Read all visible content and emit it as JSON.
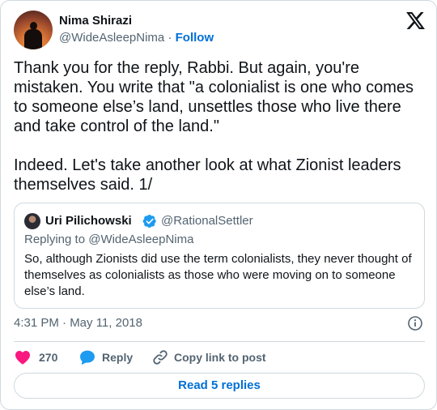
{
  "author": {
    "name": "Nima Shirazi",
    "handle": "@WideAsleepNima",
    "separator": " · ",
    "follow_label": "Follow"
  },
  "tweet": {
    "text": "Thank you for the reply, Rabbi. But again, you're\nmistaken. You write that \"a colonialist is one who comes\nto someone else’s land, unsettles those who live there\nand take control of the land.\"\n\nIndeed. Let's take another look at what Zionist leaders\nthemselves said. 1/",
    "timestamp": "4:31 PM · May 11, 2018"
  },
  "quoted_tweet": {
    "name": "Uri Pilichowski",
    "handle": "@RationalSettler",
    "replying_to": "Replying to @WideAsleepNima",
    "text": "So, although Zionists did use the term colonialists, they never thought of themselves as colonialists as those who were moving on to someone else’s land."
  },
  "actions": {
    "like_count": "270",
    "reply_label": "Reply",
    "copy_link_label": "Copy link to post"
  },
  "read_replies_label": "Read 5 replies",
  "icons": {
    "brand_logo": "x-logo-icon",
    "verified": "verified-badge-icon",
    "info": "info-icon",
    "like": "heart-icon",
    "reply": "speech-bubble-icon",
    "copy_link": "link-icon"
  },
  "colors": {
    "link_blue": "#006fd6",
    "like_red": "#f91880",
    "reply_blue": "#1d9bf0",
    "secondary_text": "#536471",
    "border": "#cfd9de"
  }
}
